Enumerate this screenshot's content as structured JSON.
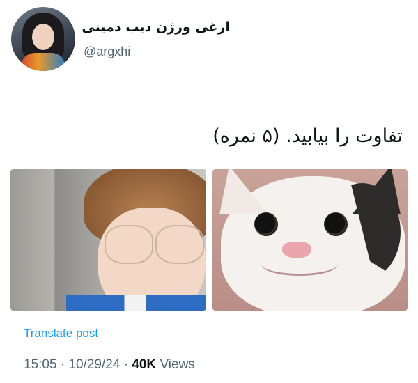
{
  "author": {
    "display_name": "ارغی ورژن دیب دمینی",
    "handle": "@argxhi"
  },
  "post": {
    "text": "تفاوت را بیابید. (۵ نمره)",
    "translate_label": "Translate post",
    "time": "15:05",
    "date": "10/29/24",
    "views_count": "40K",
    "views_label": "Views",
    "separator": "·"
  },
  "colors": {
    "link": "#1d9bf0",
    "secondary_text": "#536471",
    "primary_text": "#0f1419"
  },
  "icons": {
    "avatar": "profile-photo",
    "image_left": "boy-with-glasses-photo",
    "image_right": "smiling-cat-photo"
  }
}
